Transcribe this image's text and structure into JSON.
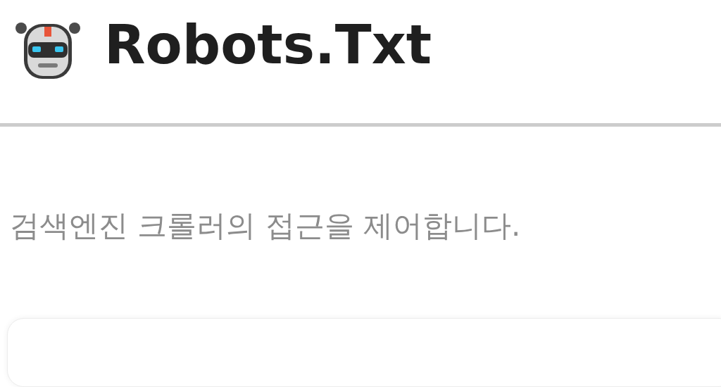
{
  "header": {
    "title": "Robots.Txt"
  },
  "description": "검색엔진 크롤러의 접근을 제어합니다."
}
